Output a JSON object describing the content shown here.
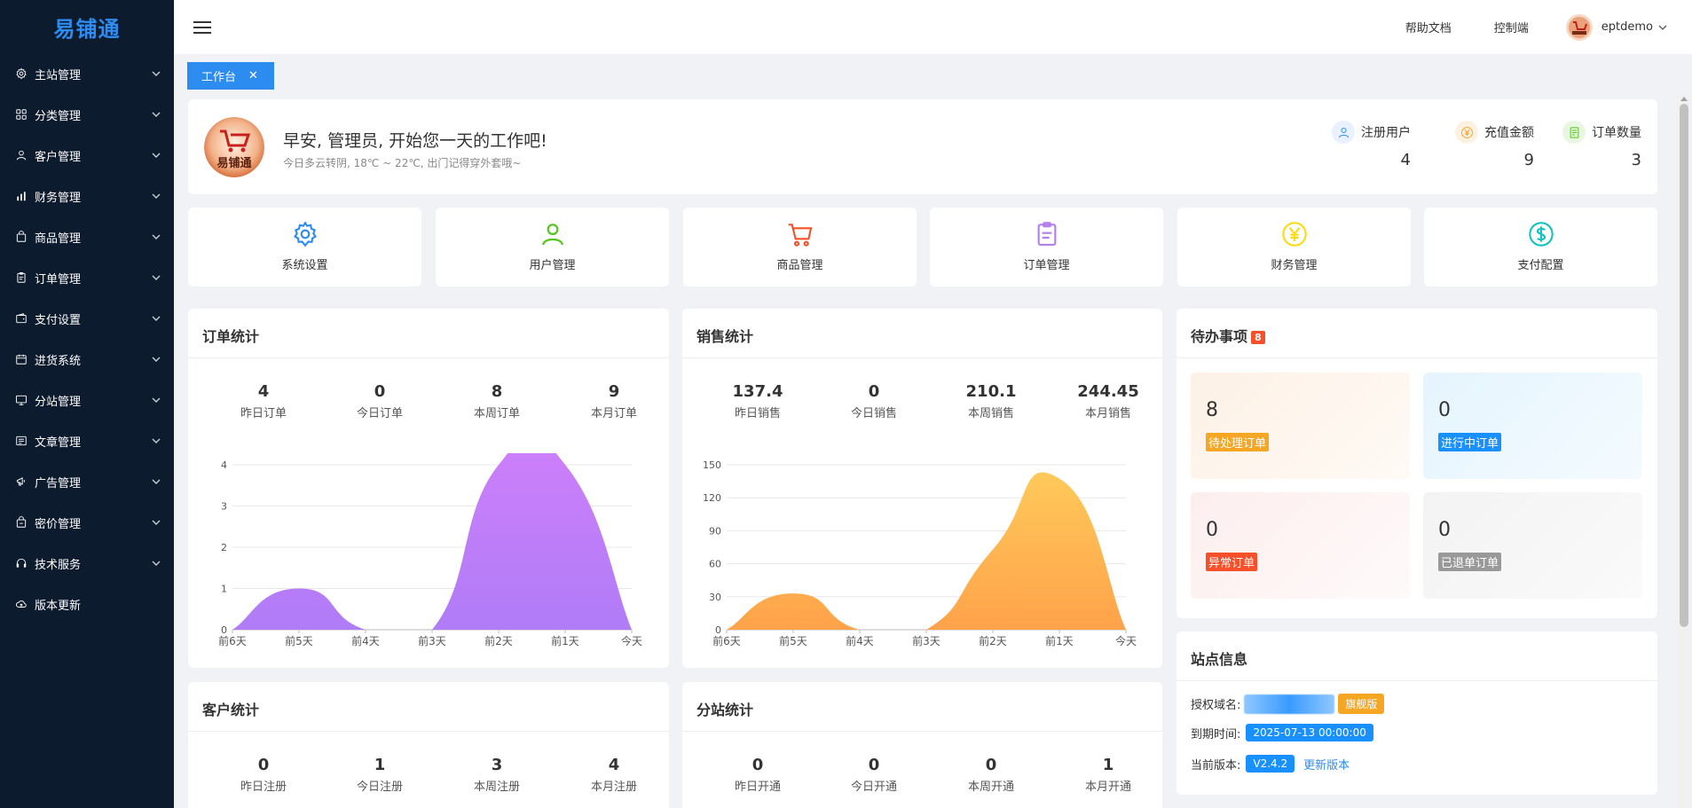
{
  "app": {
    "logo_text": "易铺通"
  },
  "sidebar": {
    "items": [
      {
        "label": "主站管理",
        "icon": "gear-icon",
        "has_children": true
      },
      {
        "label": "分类管理",
        "icon": "grid-icon",
        "has_children": true
      },
      {
        "label": "客户管理",
        "icon": "user-icon",
        "has_children": true
      },
      {
        "label": "财务管理",
        "icon": "bar-chart-icon",
        "has_children": true
      },
      {
        "label": "商品管理",
        "icon": "bag-icon",
        "has_children": true
      },
      {
        "label": "订单管理",
        "icon": "clipboard-icon",
        "has_children": true
      },
      {
        "label": "支付设置",
        "icon": "wallet-icon",
        "has_children": true
      },
      {
        "label": "进货系统",
        "icon": "calendar-icon",
        "has_children": true
      },
      {
        "label": "分站管理",
        "icon": "monitor-icon",
        "has_children": true
      },
      {
        "label": "文章管理",
        "icon": "article-icon",
        "has_children": true
      },
      {
        "label": "广告管理",
        "icon": "megaphone-icon",
        "has_children": true
      },
      {
        "label": "密价管理",
        "icon": "tag-icon",
        "has_children": true
      },
      {
        "label": "技术服务",
        "icon": "headset-icon",
        "has_children": true
      },
      {
        "label": "版本更新",
        "icon": "cloud-upload-icon",
        "has_children": false
      }
    ]
  },
  "header": {
    "help_label": "帮助文档",
    "console_label": "控制端",
    "username": "eptdemo"
  },
  "tabs": [
    {
      "label": "工作台",
      "active": true
    }
  ],
  "welcome": {
    "greeting": "早安, 管理员, 开始您一天的工作吧!",
    "weather": "今日多云转阴, 18℃ ~ 22℃, 出门记得穿外套哦~",
    "avatar_text": "易铺通",
    "stats": [
      {
        "label": "注册用户",
        "value": "4",
        "icon": "user-icon",
        "color": "#2d8cf0",
        "bg": "#e8f1fd"
      },
      {
        "label": "充值金额",
        "value": "9",
        "icon": "yen-icon",
        "color": "#f5a623",
        "bg": "#fdf2e2"
      },
      {
        "label": "订单数量",
        "value": "3",
        "icon": "list-icon",
        "color": "#52c41a",
        "bg": "#e9f7e2"
      }
    ]
  },
  "quick_links": [
    {
      "label": "系统设置",
      "icon": "gear-icon",
      "color": "#2d8cf0"
    },
    {
      "label": "用户管理",
      "icon": "user-icon",
      "color": "#52c41a"
    },
    {
      "label": "商品管理",
      "icon": "cart-icon",
      "color": "#f5502a"
    },
    {
      "label": "订单管理",
      "icon": "clipboard-icon",
      "color": "#b37feb"
    },
    {
      "label": "财务管理",
      "icon": "yen-icon",
      "color": "#fadb14"
    },
    {
      "label": "支付配置",
      "icon": "dollar-icon",
      "color": "#13c2c2"
    }
  ],
  "order_stats": {
    "title": "订单统计",
    "kpis": [
      {
        "value": "4",
        "label": "昨日订单"
      },
      {
        "value": "0",
        "label": "今日订单"
      },
      {
        "value": "8",
        "label": "本周订单"
      },
      {
        "value": "9",
        "label": "本月订单"
      }
    ]
  },
  "sales_stats": {
    "title": "销售统计",
    "kpis": [
      {
        "value": "137.4",
        "label": "昨日销售"
      },
      {
        "value": "0",
        "label": "今日销售"
      },
      {
        "value": "210.1",
        "label": "本周销售"
      },
      {
        "value": "244.45",
        "label": "本月销售"
      }
    ]
  },
  "todo": {
    "title": "待办事项",
    "count": "8",
    "items": [
      {
        "value": "8",
        "label": "待处理订单",
        "tag_color": "#f5a623"
      },
      {
        "value": "0",
        "label": "进行中订单",
        "tag_color": "#1890ff"
      },
      {
        "value": "0",
        "label": "异常订单",
        "tag_color": "#f5502a"
      },
      {
        "value": "0",
        "label": "已退单订单",
        "tag_color": "#999999"
      }
    ]
  },
  "site_info": {
    "title": "站点信息",
    "domain_label": "授权域名:",
    "edition": "旗舰版",
    "expire_label": "到期时间:",
    "expire_value": "2025-07-13 00:00:00",
    "version_label": "当前版本:",
    "version_value": "V2.4.2",
    "update_link": "更新版本"
  },
  "customer_stats": {
    "title": "客户统计",
    "kpis": [
      {
        "value": "0",
        "label": "昨日注册"
      },
      {
        "value": "1",
        "label": "今日注册"
      },
      {
        "value": "3",
        "label": "本周注册"
      },
      {
        "value": "4",
        "label": "本月注册"
      }
    ]
  },
  "branch_stats": {
    "title": "分站统计",
    "kpis": [
      {
        "value": "0",
        "label": "昨日开通"
      },
      {
        "value": "0",
        "label": "今日开通"
      },
      {
        "value": "0",
        "label": "本周开通"
      },
      {
        "value": "1",
        "label": "本月开通"
      }
    ]
  },
  "chart_data": [
    {
      "type": "area",
      "categories": [
        "前6天",
        "前5天",
        "前4天",
        "前3天",
        "前2天",
        "前1天",
        "今天"
      ],
      "series": [
        {
          "values": [
            0,
            1,
            0,
            0,
            4,
            4,
            0
          ]
        }
      ],
      "ylim": [
        0,
        4
      ],
      "yticks": [
        0,
        1,
        2,
        3,
        4
      ],
      "grid": true,
      "colors": [
        "#b07cf7",
        "#d07ffa"
      ]
    },
    {
      "type": "area",
      "categories": [
        "前6天",
        "前5天",
        "前4天",
        "前3天",
        "前2天",
        "前1天",
        "今天"
      ],
      "series": [
        {
          "values": [
            0,
            33,
            0,
            0,
            73,
            137.4,
            0
          ]
        }
      ],
      "ylim": [
        0,
        150
      ],
      "yticks": [
        0,
        30,
        60,
        90,
        120,
        150
      ],
      "grid": true,
      "colors": [
        "#ffa24a",
        "#ffc95a"
      ]
    }
  ]
}
